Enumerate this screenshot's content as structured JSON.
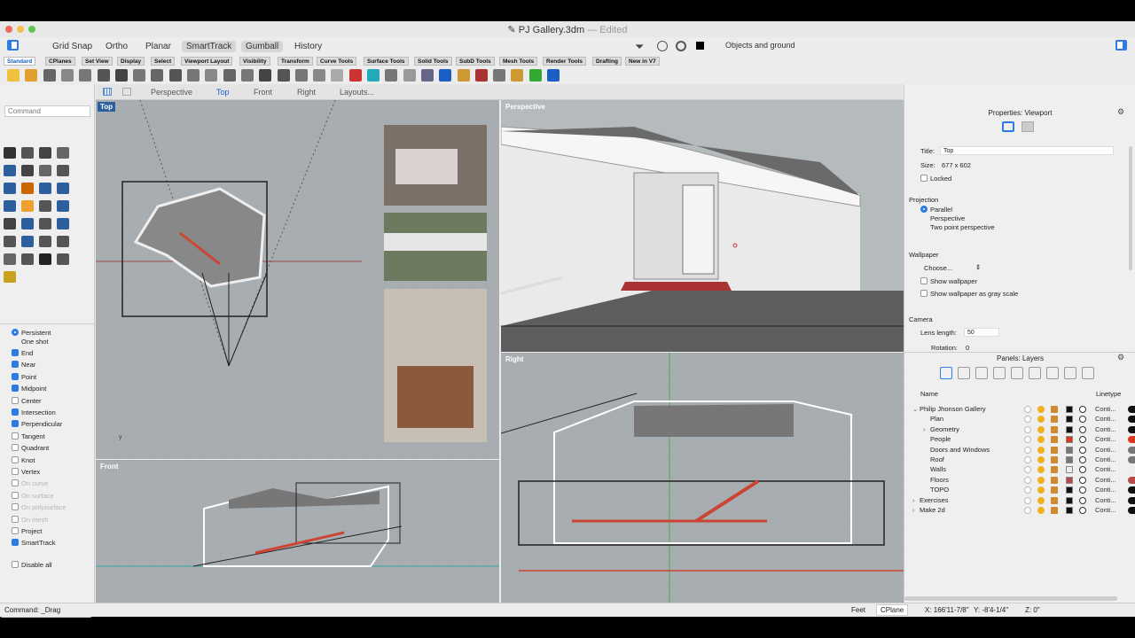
{
  "window": {
    "title": "PJ Gallery.3dm",
    "edited": "Edited",
    "separator": "—"
  },
  "toolbar": {
    "grid_snap": "Grid Snap",
    "ortho": "Ortho",
    "planar": "Planar",
    "smarttrack": "SmartTrack",
    "gumball": "Gumball",
    "history": "History",
    "filter": "Objects and ground"
  },
  "tabs": [
    "Standard",
    "CPlanes",
    "Set View",
    "Display",
    "Select",
    "Viewport Layout",
    "Visibility",
    "Transform",
    "Curve Tools",
    "Surface Tools",
    "Solid Tools",
    "SubD Tools",
    "Mesh Tools",
    "Render Tools",
    "Drafting",
    "New in V7"
  ],
  "command": {
    "placeholder": "Command"
  },
  "osnap": {
    "persistent": "Persistent",
    "one_shot": "One shot",
    "items": [
      {
        "label": "End",
        "checked": true,
        "enabled": true
      },
      {
        "label": "Near",
        "checked": true,
        "enabled": true
      },
      {
        "label": "Point",
        "checked": true,
        "enabled": true
      },
      {
        "label": "Midpoint",
        "checked": true,
        "enabled": true
      },
      {
        "label": "Center",
        "checked": false,
        "enabled": true
      },
      {
        "label": "Intersection",
        "checked": true,
        "enabled": true
      },
      {
        "label": "Perpendicular",
        "checked": true,
        "enabled": true
      },
      {
        "label": "Tangent",
        "checked": false,
        "enabled": true
      },
      {
        "label": "Quadrant",
        "checked": false,
        "enabled": true
      },
      {
        "label": "Knot",
        "checked": false,
        "enabled": true
      },
      {
        "label": "Vertex",
        "checked": false,
        "enabled": true
      },
      {
        "label": "On curve",
        "checked": false,
        "enabled": false
      },
      {
        "label": "On surface",
        "checked": false,
        "enabled": false
      },
      {
        "label": "On polysurface",
        "checked": false,
        "enabled": false
      },
      {
        "label": "On mesh",
        "checked": false,
        "enabled": false
      },
      {
        "label": "Project",
        "checked": false,
        "enabled": true
      },
      {
        "label": "SmartTrack",
        "checked": true,
        "enabled": true
      }
    ],
    "disable_all": "Disable all"
  },
  "viewport_tabs": {
    "perspective": "Perspective",
    "top": "Top",
    "front": "Front",
    "right": "Right",
    "layouts": "Layouts..."
  },
  "viewports": {
    "top": "Top",
    "perspective": "Perspective",
    "front": "Front",
    "right": "Right"
  },
  "properties": {
    "header": "Properties: Viewport",
    "title_label": "Title:",
    "title_value": "Top",
    "size_label": "Size:",
    "size_value": "677 x 602",
    "locked": "Locked",
    "projection": "Projection",
    "parallel": "Parallel",
    "perspective": "Perspective",
    "two_point": "Two point perspective",
    "wallpaper": "Wallpaper",
    "choose": "Choose...",
    "show_wallpaper": "Show wallpaper",
    "gray_scale": "Show wallpaper as gray scale",
    "camera": "Camera",
    "lens_label": "Lens length:",
    "lens_value": "50",
    "rotation_label": "Rotation:",
    "rotation_value": "0"
  },
  "layers": {
    "header": "Panels: Layers",
    "col_name": "Name",
    "col_linetype": "Linetype",
    "rows": [
      {
        "name": "Philip Jhonson Gallery",
        "indent": 0,
        "expander": "⌄",
        "color": "#111111",
        "linetype": "Conti..."
      },
      {
        "name": "Plan",
        "indent": 1,
        "expander": "",
        "color": "#111111",
        "linetype": "Conti..."
      },
      {
        "name": "Geometry",
        "indent": 1,
        "expander": "›",
        "color": "#111111",
        "linetype": "Conti..."
      },
      {
        "name": "People",
        "indent": 1,
        "expander": "",
        "color": "#d9381e",
        "linetype": "Conti..."
      },
      {
        "name": "Doors and Windows",
        "indent": 1,
        "expander": "",
        "color": "#777777",
        "linetype": "Conti..."
      },
      {
        "name": "Roof",
        "indent": 1,
        "expander": "",
        "color": "#777777",
        "linetype": "Conti..."
      },
      {
        "name": "Walls",
        "indent": 1,
        "expander": "",
        "color": "#eeeeee",
        "linetype": "Conti..."
      },
      {
        "name": "Floors",
        "indent": 1,
        "expander": "",
        "color": "#b44a4a",
        "linetype": "Conti..."
      },
      {
        "name": "TOPO",
        "indent": 1,
        "expander": "",
        "color": "#111111",
        "linetype": "Conti..."
      },
      {
        "name": "Exercises",
        "indent": 0,
        "expander": "›",
        "color": "#111111",
        "linetype": "Conti..."
      },
      {
        "name": "Make 2d",
        "indent": 0,
        "expander": "›",
        "color": "#111111",
        "linetype": "Conti..."
      }
    ]
  },
  "status": {
    "command": "Command: _Drag",
    "units": "Feet",
    "cplane": "CPlane",
    "x": "X: 166'11-7/8\"",
    "y": "Y: -8'4-1/4\"",
    "z": "Z: 0\""
  }
}
